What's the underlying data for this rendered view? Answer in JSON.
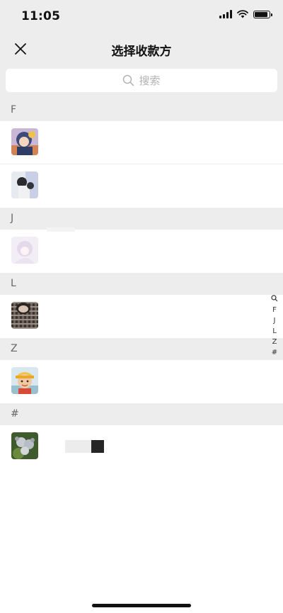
{
  "status": {
    "time": "11:05"
  },
  "nav": {
    "title": "选择收款方"
  },
  "search": {
    "placeholder": "搜索"
  },
  "sections": [
    {
      "letter": "F",
      "contacts": [
        {
          "avatar": "cartoon-avatar"
        },
        {
          "avatar": "photo-avatar"
        }
      ]
    },
    {
      "letter": "J",
      "contacts": [
        {
          "avatar": "anime-avatar"
        }
      ]
    },
    {
      "letter": "L",
      "contacts": [
        {
          "avatar": "plaid-avatar"
        }
      ]
    },
    {
      "letter": "Z",
      "contacts": [
        {
          "avatar": "cartoon-boy-avatar"
        }
      ]
    },
    {
      "letter": "#",
      "contacts": [
        {
          "avatar": "koala-avatar"
        }
      ]
    }
  ],
  "index": [
    "F",
    "J",
    "L",
    "Z",
    "#"
  ]
}
